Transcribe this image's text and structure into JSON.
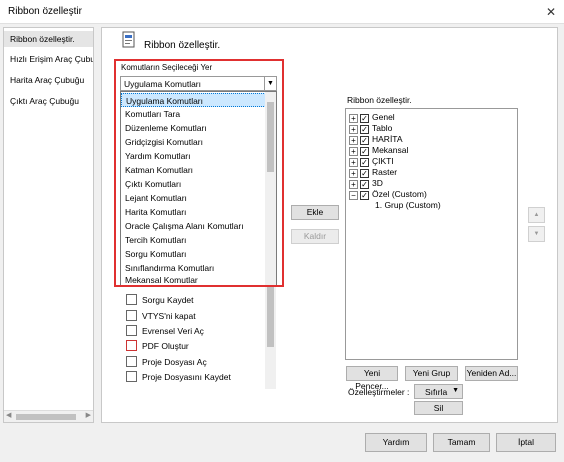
{
  "window": {
    "title": "Ribbon özelleştir",
    "close": "✕"
  },
  "sidebar": {
    "items": [
      {
        "label": "Ribbon özelleştir."
      },
      {
        "label": "Hızlı Erişim Araç Çubuğu"
      },
      {
        "label": "Harita Araç Çubuğu"
      },
      {
        "label": "Çıktı Araç Çubuğu"
      }
    ]
  },
  "main": {
    "heading": "Ribbon özelleştir.",
    "commands_label": "Komutların Seçileceği Yer",
    "combo_value": "Uygulama Komutları",
    "dropdown_options": [
      "Uygulama Komutları",
      "Komutları Tara",
      "Düzenleme Komutları",
      "Gridçizgisi Komutları",
      "Yardım Komutları",
      "Katman Komutları",
      "Çıktı Komutları",
      "Lejant Komutları",
      "Harita Komutları",
      "Oracle Çalışma Alanı Komutları",
      "Tercih Komutları",
      "Sorgu Komutları",
      "Sınıflandırma Komutları",
      "Mekansal Komutlar"
    ],
    "command_list": [
      "Sorgu Kaydet",
      "VTYS'ni kapat",
      "Evrensel Veri Aç",
      "PDF Oluştur",
      "Proje Dosyası Aç",
      "Proje Dosyasını Kaydet"
    ],
    "add_button": "Ekle",
    "remove_button": "Kaldır",
    "ribbon_label": "Ribbon özelleştir.",
    "tree": [
      {
        "label": "Genel",
        "expander": "+"
      },
      {
        "label": "Tablo",
        "expander": "+"
      },
      {
        "label": "HARİTA",
        "expander": "+"
      },
      {
        "label": "Mekansal",
        "expander": "+"
      },
      {
        "label": "ÇIKTI",
        "expander": "+"
      },
      {
        "label": "Raster",
        "expander": "+"
      },
      {
        "label": "3D",
        "expander": "+"
      },
      {
        "label": "Özel  (Custom)",
        "expander": "−"
      }
    ],
    "tree_child": "1. Grup  (Custom)",
    "up_arrow": "▲",
    "down_arrow": "▼",
    "new_tab_button": "Yeni Pencer...",
    "new_group_button": "Yeni Grup",
    "rename_button": "Yeniden Ad...",
    "customizations_label": "Özelleştirmeler :",
    "reset_value": "Sıfırla",
    "delete_button": "Sil"
  },
  "footer": {
    "help": "Yardım",
    "ok": "Tamam",
    "cancel": "İptal"
  }
}
